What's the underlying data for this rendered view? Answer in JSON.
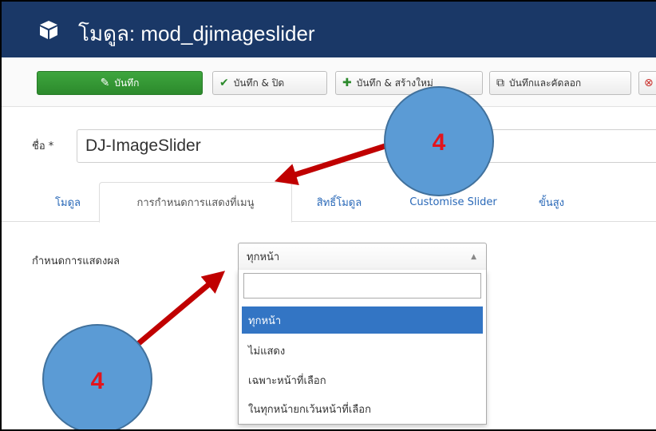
{
  "header": {
    "title": "โมดูล: mod_djimageslider",
    "icon": "cube-icon"
  },
  "toolbar": {
    "save_label": "บันทึก",
    "save_close_label": "บันทึก & ปิด",
    "save_new_label": "บันทึก & สร้างใหม่",
    "save_copy_label": "บันทึกและคัดลอก"
  },
  "form": {
    "name_label": "ชื่อ *",
    "name_value": "DJ-ImageSlider"
  },
  "tabs": [
    {
      "label": "โมดูล",
      "active": false
    },
    {
      "label": "การกำหนดการแสดงที่เมนู",
      "active": true
    },
    {
      "label": "สิทธิ์โมดูล",
      "active": false
    },
    {
      "label": "Customise Slider",
      "active": false
    },
    {
      "label": "ขั้นสูง",
      "active": false
    }
  ],
  "assignment": {
    "label": "กำหนดการแสดงผล",
    "selected": "ทุกหน้า",
    "search_value": "",
    "options": [
      {
        "label": "ทุกหน้า",
        "selected": true
      },
      {
        "label": "ไม่แสดง",
        "selected": false
      },
      {
        "label": "เฉพาะหน้าที่เลือก",
        "selected": false
      },
      {
        "label": "ในทุกหน้ายกเว้นหน้าที่เลือก",
        "selected": false
      }
    ]
  },
  "annotations": [
    {
      "label": "4"
    },
    {
      "label": "4"
    }
  ],
  "colors": {
    "header_bg": "#1a3867",
    "save_green": "#2c8a2c",
    "option_highlight": "#3375c4",
    "arrow_red": "#c00000",
    "marker_fill": "#5b9bd5"
  }
}
